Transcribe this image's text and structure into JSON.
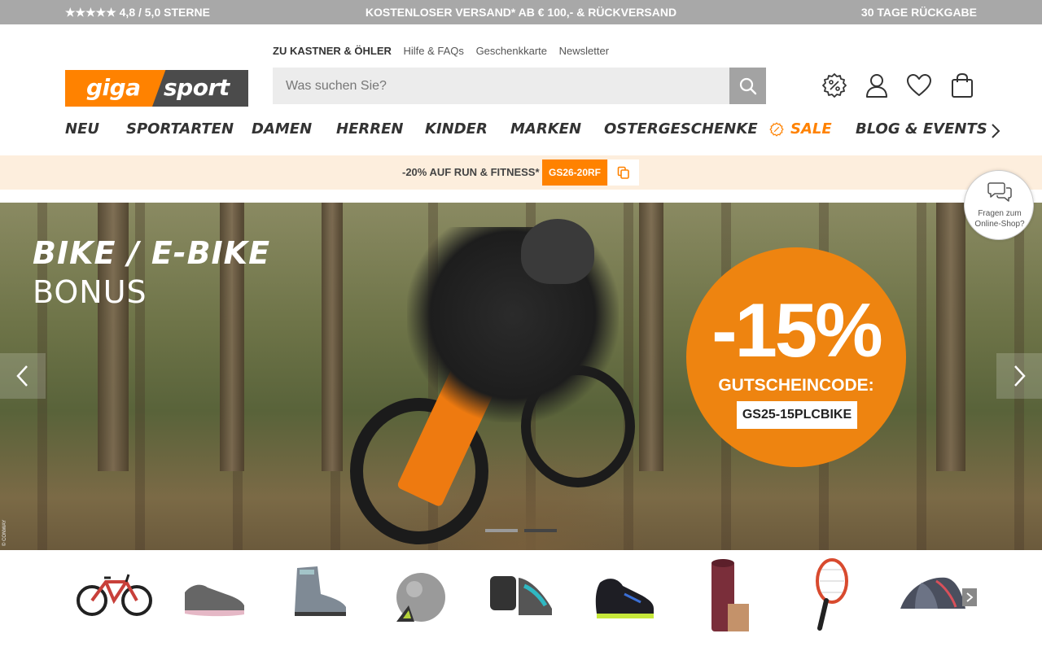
{
  "topbar": {
    "rating": "★★★★★ 4,8 / 5,0 STERNE",
    "shipping": "KOSTENLOSER VERSAND* AB € 100,- & RÜCKVERSAND",
    "returns": "30 TAGE RÜCKGABE"
  },
  "logo": {
    "part1": "giga",
    "part2": "sport"
  },
  "service_links": [
    "ZU KASTNER & ÖHLER",
    "Hilfe & FAQs",
    "Geschenkkarte",
    "Newsletter"
  ],
  "search": {
    "placeholder": "Was suchen Sie?",
    "value": ""
  },
  "header_icons": [
    "percent-badge-icon",
    "user-icon",
    "heart-icon",
    "shopping-bag-icon"
  ],
  "nav": {
    "items": [
      "NEU",
      "SPORTARTEN",
      "DAMEN",
      "HERREN",
      "KINDER",
      "MARKEN",
      "OSTERGESCHENKE",
      "SALE",
      "BLOG & EVENTS"
    ]
  },
  "promo": {
    "text": "-20% AUF RUN & FITNESS*",
    "code": "GS26-20RF"
  },
  "hero": {
    "title_line1": "BIKE / E-BIKE",
    "title_line2": "BONUS",
    "discount": "-15%",
    "code_label": "GUTSCHEINCODE:",
    "code": "GS25-15PLCBIKE",
    "credit": "© CONWAY",
    "slides": 2,
    "active_slide": 2
  },
  "chat": {
    "text": "Fragen zum Online-Shop?"
  },
  "categories": [
    "bike-icon",
    "running-shoe-icon",
    "hiking-boot-icon",
    "fitness-ball-icon",
    "climbing-gear-icon",
    "football-boot-icon",
    "yoga-mat-icon",
    "tennis-racket-icon",
    "tent-icon"
  ],
  "colors": {
    "brand_orange": "#ff8200",
    "logo_dark": "#4b4b4b",
    "topbar": "#a8a8a8",
    "promo_bg": "#fdeedd"
  }
}
